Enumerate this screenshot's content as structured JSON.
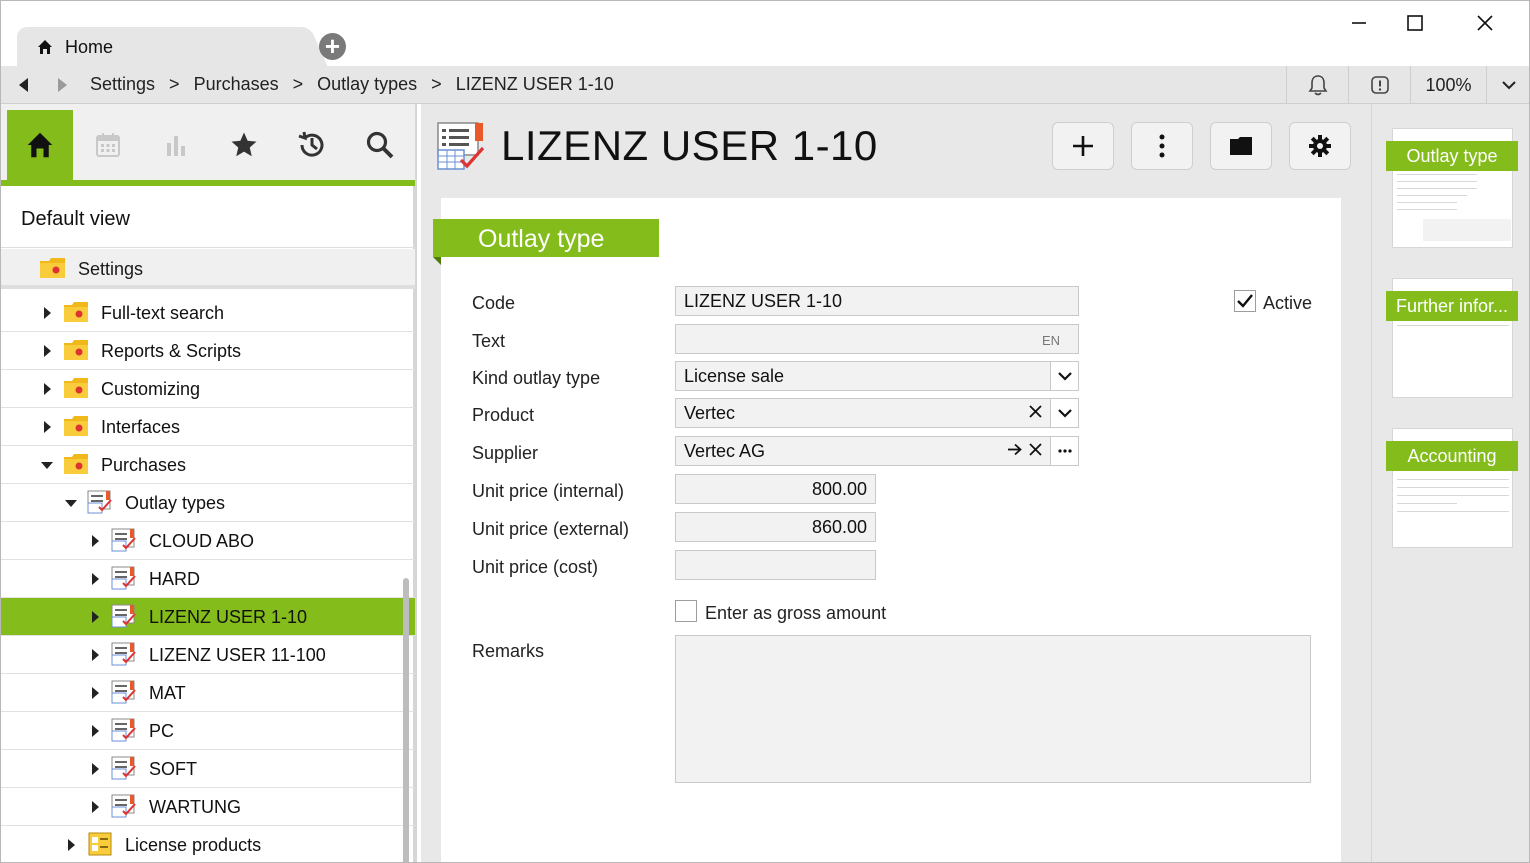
{
  "tab": {
    "label": "Home"
  },
  "breadcrumb": [
    "Settings",
    "Purchases",
    "Outlay types",
    "LIZENZ USER 1-10"
  ],
  "breadcrumb_sep": ">",
  "zoom": "100%",
  "left": {
    "default_view": "Default view",
    "settings": "Settings",
    "tree": [
      {
        "label": "Full-text search",
        "level": 1,
        "expanded": false,
        "icon": "folder-icon"
      },
      {
        "label": "Reports & Scripts",
        "level": 1,
        "expanded": false,
        "icon": "folder-icon"
      },
      {
        "label": "Customizing",
        "level": 1,
        "expanded": false,
        "icon": "folder-icon"
      },
      {
        "label": "Interfaces",
        "level": 1,
        "expanded": false,
        "icon": "folder-icon"
      },
      {
        "label": "Purchases",
        "level": 1,
        "expanded": true,
        "icon": "folder-icon"
      },
      {
        "label": "Outlay types",
        "level": 2,
        "expanded": true,
        "icon": "outlay-list-icon"
      },
      {
        "label": "CLOUD ABO",
        "level": 3,
        "expanded": false,
        "icon": "outlay-type-icon"
      },
      {
        "label": "HARD",
        "level": 3,
        "expanded": false,
        "icon": "outlay-type-icon"
      },
      {
        "label": "LIZENZ USER 1-10",
        "level": 3,
        "expanded": false,
        "icon": "outlay-type-icon",
        "selected": true
      },
      {
        "label": "LIZENZ USER 11-100",
        "level": 3,
        "expanded": false,
        "icon": "outlay-type-icon"
      },
      {
        "label": "MAT",
        "level": 3,
        "expanded": false,
        "icon": "outlay-type-icon"
      },
      {
        "label": "PC",
        "level": 3,
        "expanded": false,
        "icon": "outlay-type-icon"
      },
      {
        "label": "SOFT",
        "level": 3,
        "expanded": false,
        "icon": "outlay-type-icon"
      },
      {
        "label": "WARTUNG",
        "level": 3,
        "expanded": false,
        "icon": "outlay-type-icon"
      },
      {
        "label": "License products",
        "level": 2,
        "expanded": false,
        "icon": "license-products-icon"
      }
    ]
  },
  "main": {
    "title": "LIZENZ USER 1-10",
    "section": "Outlay type",
    "fields": {
      "code": {
        "label": "Code",
        "value": "LIZENZ USER 1-10"
      },
      "text": {
        "label": "Text",
        "value": "",
        "lang": "EN"
      },
      "kind": {
        "label": "Kind outlay type",
        "value": "License sale"
      },
      "product": {
        "label": "Product",
        "value": "Vertec"
      },
      "supplier": {
        "label": "Supplier",
        "value": "Vertec AG"
      },
      "price_internal": {
        "label": "Unit price (internal)",
        "value": "800.00"
      },
      "price_external": {
        "label": "Unit price (external)",
        "value": "860.00"
      },
      "price_cost": {
        "label": "Unit price (cost)",
        "value": ""
      },
      "remarks": {
        "label": "Remarks",
        "value": ""
      }
    },
    "active": {
      "label": "Active",
      "checked": true
    },
    "gross": {
      "label": "Enter as gross amount",
      "checked": false
    }
  },
  "right": {
    "pages": [
      "Outlay type",
      "Further infor...",
      "Accounting"
    ]
  },
  "colors": {
    "accent": "#84bc1c",
    "accent_dark": "#4f7a0c",
    "panel": "#e8e8e8"
  }
}
